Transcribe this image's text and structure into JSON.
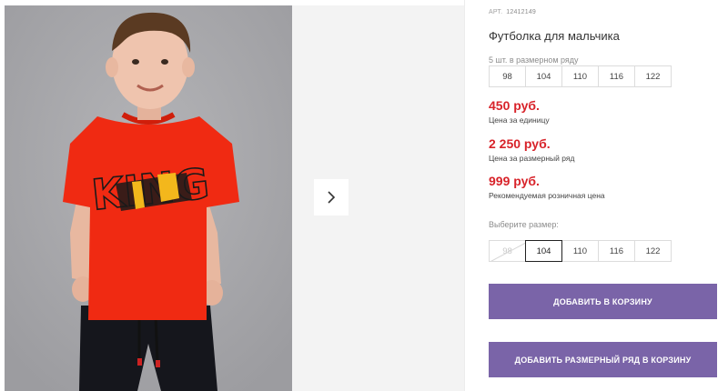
{
  "product": {
    "sku_label": "АРТ.",
    "sku": "12412149",
    "title": "Футболка для мальчика",
    "size_row_note": "5 шт. в размерном ряду",
    "size_row": [
      "98",
      "104",
      "110",
      "116",
      "122"
    ],
    "prices": [
      {
        "value": "450 руб.",
        "note": "Цена за единицу"
      },
      {
        "value": "2 250 руб.",
        "note": "Цена за размерный ряд"
      },
      {
        "value": "999 руб.",
        "note": "Рекомендуемая розничная цена"
      }
    ],
    "choose_size_label": "Выберите размер:",
    "sizes": [
      {
        "label": "98",
        "state": "disabled"
      },
      {
        "label": "104",
        "state": "selected"
      },
      {
        "label": "110",
        "state": "available"
      },
      {
        "label": "116",
        "state": "available"
      },
      {
        "label": "122",
        "state": "available"
      }
    ]
  },
  "actions": {
    "add_to_cart": "ДОБАВИТЬ В КОРЗИНУ",
    "add_size_row_to_cart": "ДОБАВИТЬ РАЗМЕРНЫЙ РЯД В КОРЗИНУ"
  },
  "gallery": {
    "next_icon": "chevron-right-icon",
    "tshirt_print": "KING"
  },
  "colors": {
    "price": "#d8232a",
    "button": "#7a64a8",
    "photo_bg": "#a9a9ac",
    "tshirt": "#f02a12"
  }
}
